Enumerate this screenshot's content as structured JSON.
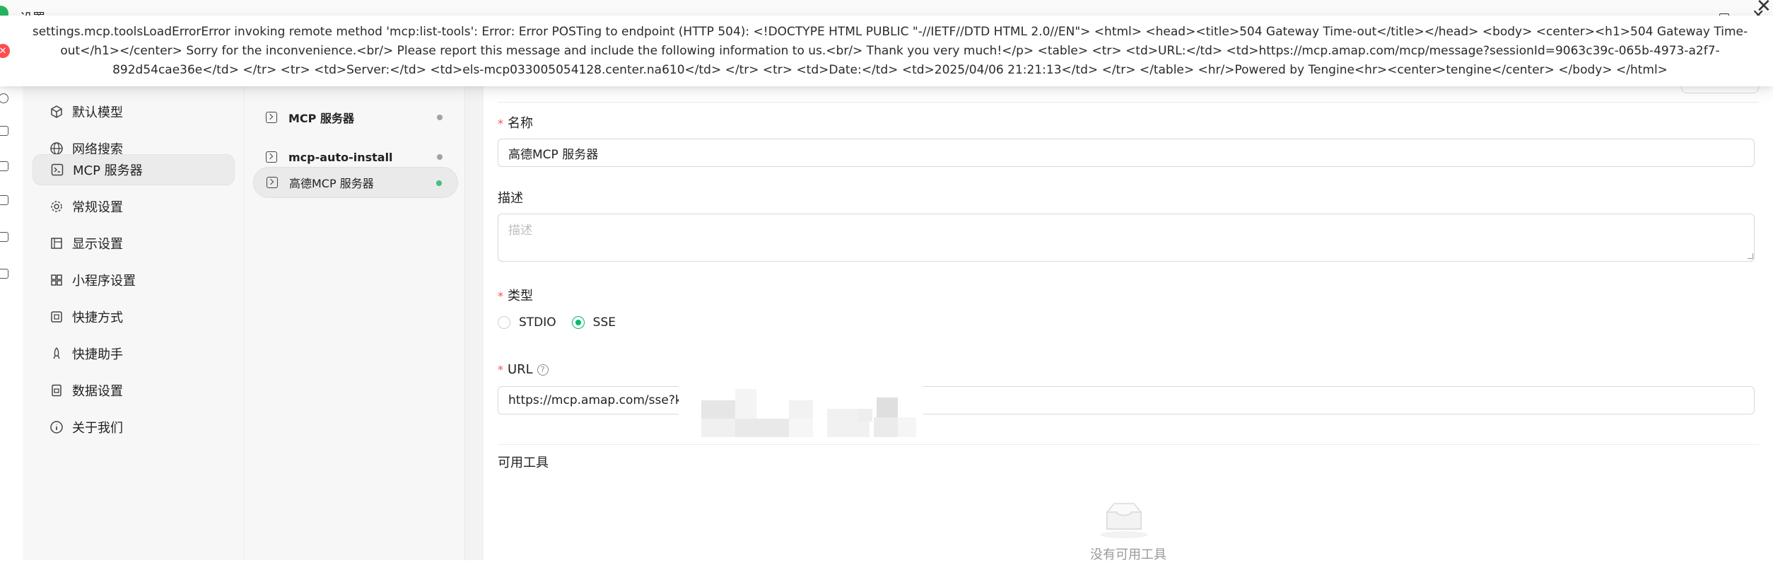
{
  "window": {
    "title": "设置",
    "close_glyph": "✕",
    "minimize_glyph": "—"
  },
  "settings_nav": {
    "items": [
      {
        "label": "默认模型",
        "icon": "cube-icon"
      },
      {
        "label": "网络搜索",
        "icon": "globe-icon"
      },
      {
        "label": "MCP 服务器",
        "icon": "terminal-icon",
        "active": true
      },
      {
        "label": "常规设置",
        "icon": "gear-icon"
      },
      {
        "label": "显示设置",
        "icon": "layout-icon"
      },
      {
        "label": "小程序设置",
        "icon": "grid-icon"
      },
      {
        "label": "快捷方式",
        "icon": "command-icon"
      },
      {
        "label": "快捷助手",
        "icon": "rocket-icon"
      },
      {
        "label": "数据设置",
        "icon": "database-icon"
      },
      {
        "label": "关于我们",
        "icon": "info-icon"
      }
    ]
  },
  "server_list": {
    "items": [
      {
        "label": "MCP 服务器",
        "status": "off"
      },
      {
        "label": "mcp-auto-install",
        "status": "off"
      },
      {
        "label": "高德MCP 服务器",
        "status": "on",
        "active": true
      }
    ]
  },
  "form": {
    "name_label": "名称",
    "name_value": "高德MCP 服务器",
    "desc_label": "描述",
    "desc_placeholder": "描述",
    "type_label": "类型",
    "type_options": [
      "STDIO",
      "SSE"
    ],
    "type_selected": "SSE",
    "url_label": "URL",
    "url_value": "https://mcp.amap.com/sse?key",
    "help_glyph": "?",
    "required_mark": "*"
  },
  "tools": {
    "title": "可用工具",
    "empty_text": "没有可用工具"
  },
  "error_toast": {
    "icon_glyph": "✕",
    "message": "settings.mcp.toolsLoadErrorError invoking remote method 'mcp:list-tools': Error: Error POSTing to endpoint (HTTP 504): <!DOCTYPE HTML PUBLIC \"-//IETF//DTD HTML 2.0//EN\"> <html> <head><title>504 Gateway Time-out</title></head> <body> <center><h1>504 Gateway Time-out</h1></center> Sorry for the inconvenience.<br/> Please report this message and include the following information to us.<br/> Thank you very much!</p> <table> <tr> <td>URL:</td> <td>https://mcp.amap.com/mcp/message?sessionId=9063c39c-065b-4973-a2f7-892d54cae36e</td> </tr> <tr> <td>Server:</td> <td>els-mcp033005054128.center.na610</td> </tr> <tr> <td>Date:</td> <td>2025/04/06 21:21:13</td> </tr> </table> <hr/>Powered by Tengine<hr><center>tengine</center> </body> </html>",
    "close_glyph": "✕"
  },
  "colors": {
    "accent": "#00b96b",
    "error": "#ff4d4f",
    "status_on": "#3fc27a",
    "status_off": "#a3a3a3"
  }
}
